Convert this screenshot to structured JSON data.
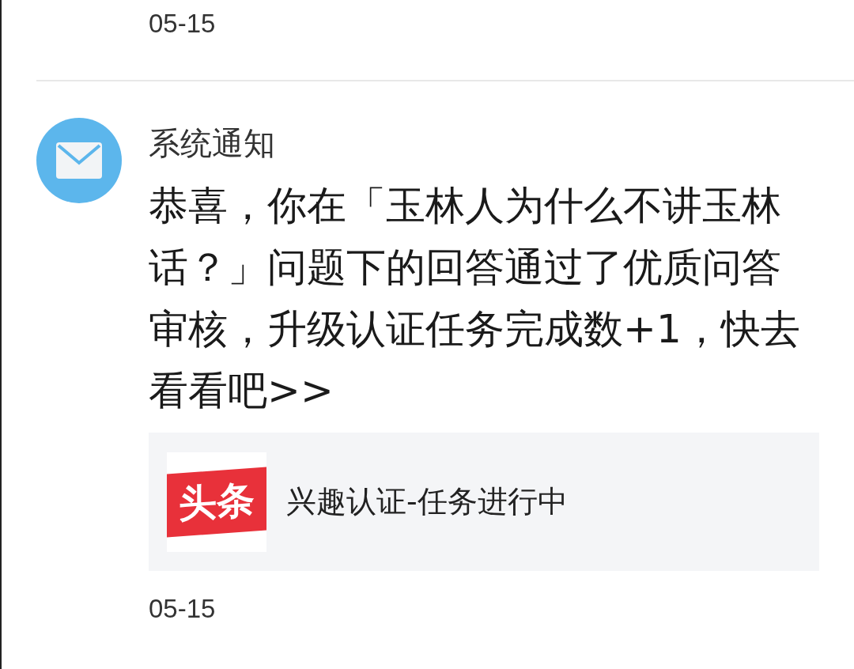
{
  "notifications": [
    {
      "kind": "date_only",
      "date": "05-15"
    },
    {
      "kind": "message",
      "sender": "系统通知",
      "text": "恭喜，你在「玉林人为什么不讲玉林话？」问题下的回答通过了优质问答审核，升级认证任务完成数+1，快去看看吧>>",
      "card": {
        "logo_text": "头条",
        "title": "兴趣认证-任务进行中"
      },
      "date": "05-15"
    }
  ]
}
